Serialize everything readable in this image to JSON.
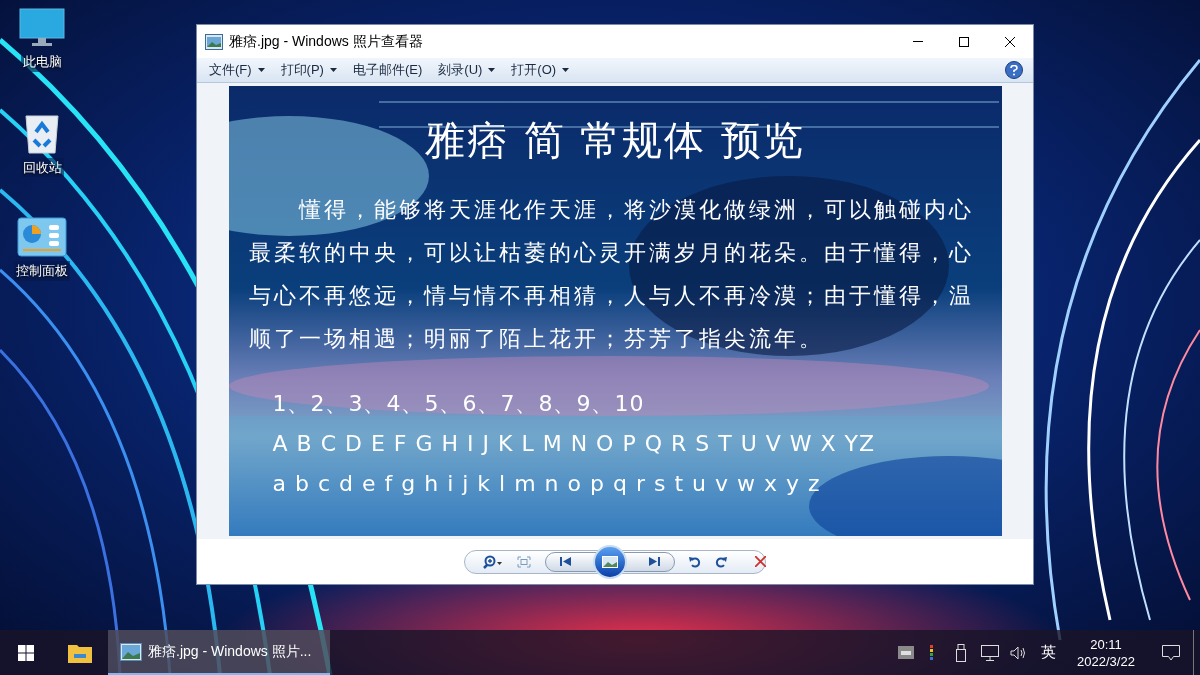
{
  "desktop_icons": [
    {
      "kind": "computer",
      "label": "此电脑"
    },
    {
      "kind": "recycle-bin",
      "label": "回收站"
    },
    {
      "kind": "control-panel",
      "label": "控制面板"
    }
  ],
  "window": {
    "title": "雅痞.jpg - Windows 照片查看器"
  },
  "menu": [
    {
      "label": "文件(F)",
      "dropdown": true
    },
    {
      "label": "打印(P)",
      "dropdown": true
    },
    {
      "label": "电子邮件(E)",
      "dropdown": false
    },
    {
      "label": "刻录(U)",
      "dropdown": true
    },
    {
      "label": "打开(O)",
      "dropdown": true
    }
  ],
  "image": {
    "title": "雅痞 简 常规体 预览",
    "paragraph": "懂得，能够将天涯化作天涯，将沙漠化做绿洲，可以触碰内心最柔软的中央，可以让枯萎的心灵开满岁月的花朵。由于懂得，心与心不再悠远，情与情不再相猜，人与人不再冷漠；由于懂得，温顺了一场相遇；明丽了陌上花开；芬芳了指尖流年。",
    "lines": [
      "1、2、3、4、5、6、7、8、9、10",
      "A B C D E F G H I J K L M N O P Q R S T U V W X YZ",
      "a b c d e f g h i j k l m n o p q r s t u v w x y z"
    ]
  },
  "taskbar": {
    "apps": [
      {
        "kind": "start",
        "selected": false
      },
      {
        "kind": "explorer",
        "selected": false
      },
      {
        "kind": "window",
        "label": "雅痞.jpg - Windows 照片...",
        "selected": true
      }
    ],
    "ime": "英",
    "time": "20:11",
    "date": "2022/3/22"
  }
}
